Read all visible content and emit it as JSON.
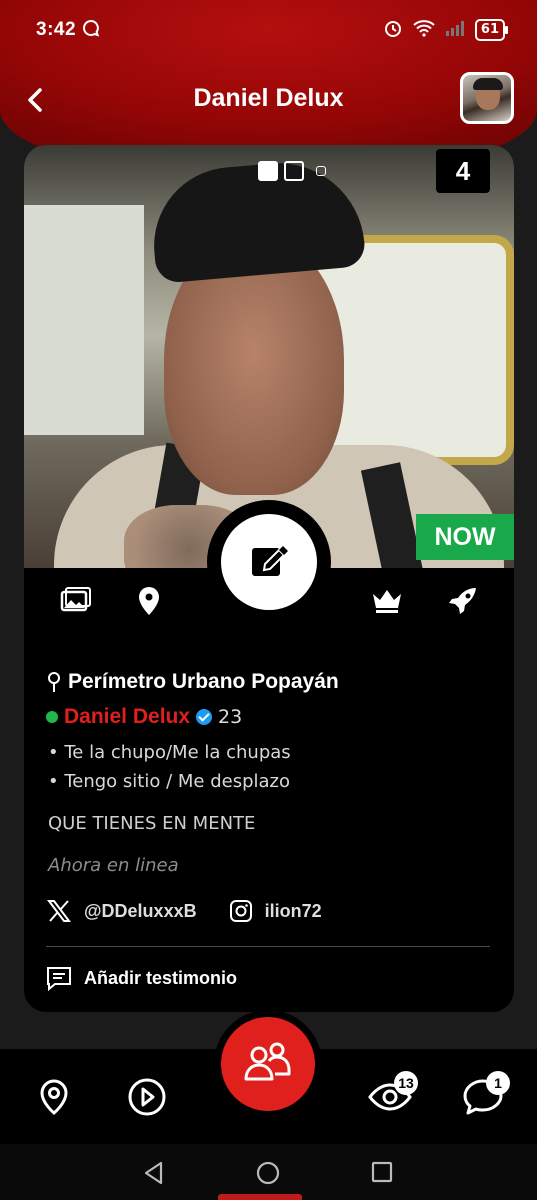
{
  "status_bar": {
    "time": "3:42",
    "battery": "61"
  },
  "header": {
    "title": "Daniel Delux"
  },
  "photo": {
    "page_count": "4",
    "now_badge": "NOW"
  },
  "profile": {
    "location": "Perímetro Urbano Popayán",
    "name": "Daniel Delux",
    "age": "23",
    "bullets": [
      "• Te la chupo/Me la chupas",
      "• Tengo sitio / Me desplazo"
    ],
    "mind": "QUE TIENES EN MENTE",
    "online_status": "Ahora en linea",
    "twitter": "@DDeluxxxB",
    "instagram": "ilion72",
    "testimonial": "Añadir testimonio"
  },
  "bottom_nav": {
    "views_badge": "13",
    "messages_badge": "1"
  },
  "colors": {
    "brand_red": "#e0201c",
    "header_red": "#950606",
    "online_green": "#1fb84b",
    "now_green": "#19a84a"
  }
}
